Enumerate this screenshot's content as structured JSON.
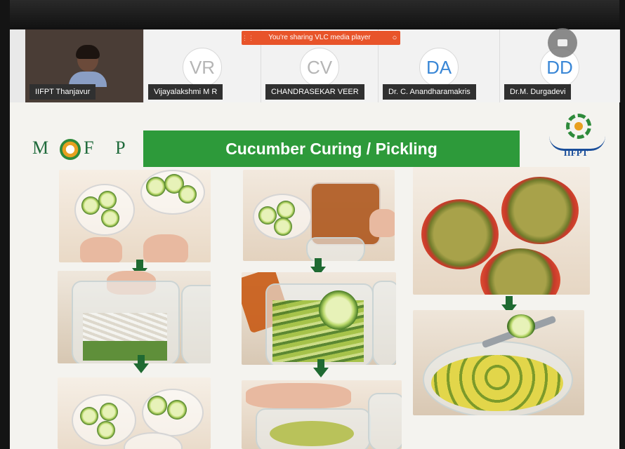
{
  "meeting": {
    "share_banner": "You're sharing VLC media player",
    "participants": [
      {
        "name": "IIFPT Thanjavur",
        "initials": ""
      },
      {
        "name": "Vijayalakshmi M R",
        "initials": "VR"
      },
      {
        "name": "CHANDRASEKAR VEER",
        "initials": "CV"
      },
      {
        "name": "Dr. C. Anandharamakris",
        "initials": "DA"
      },
      {
        "name": "Dr.M. Durgadevi",
        "initials": "DD"
      }
    ]
  },
  "slide": {
    "title": "Cucumber Curing / Pickling",
    "logo_left": "MOFPI",
    "logo_left_parts": [
      "M",
      "F P I"
    ],
    "logo_right": "IIFPT"
  },
  "colors": {
    "title_bar": "#2d9a3a",
    "share_banner": "#e8542a",
    "initials_highlight": "#3a87d6"
  }
}
